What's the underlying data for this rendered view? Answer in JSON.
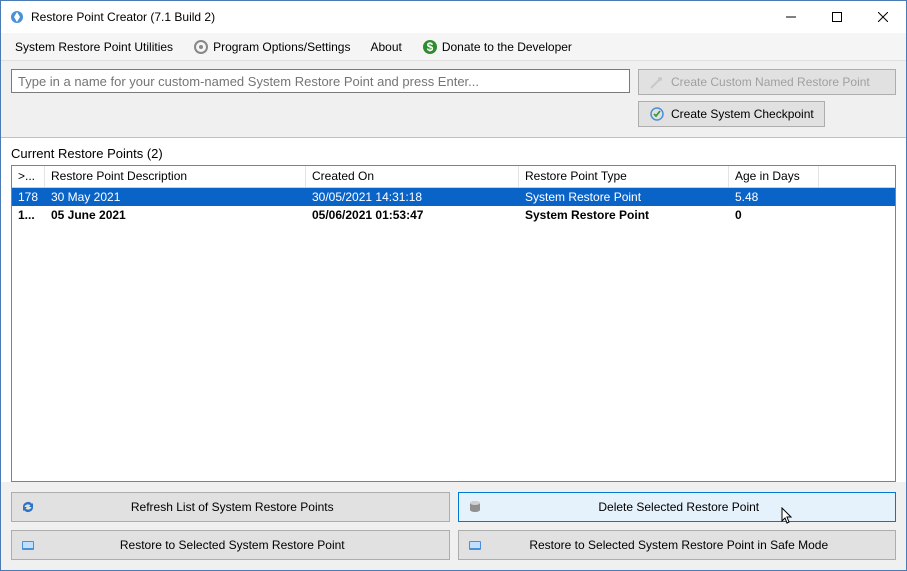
{
  "window": {
    "title": "Restore Point Creator (7.1 Build 2)"
  },
  "menu": {
    "utilities": "System Restore Point Utilities",
    "options": "Program Options/Settings",
    "about": "About",
    "donate": "Donate to the Developer"
  },
  "top": {
    "name_placeholder": "Type in a name for your custom-named System Restore Point and press Enter...",
    "create_named": "Create Custom Named Restore Point",
    "create_checkpoint": "Create System Checkpoint"
  },
  "list": {
    "label": "Current Restore Points (2)",
    "headers": {
      "id": ">...",
      "desc": "Restore Point Description",
      "created": "Created On",
      "type": "Restore Point Type",
      "age": "Age in Days"
    },
    "rows": [
      {
        "id": "178",
        "desc": "30 May 2021",
        "created": "30/05/2021 14:31:18",
        "type": "System Restore Point",
        "age": "5.48",
        "selected": true
      },
      {
        "id": "1...",
        "desc": "05 June 2021",
        "created": "05/06/2021 01:53:47",
        "type": "System Restore Point",
        "age": "0",
        "bold": true
      }
    ]
  },
  "bottom": {
    "refresh": "Refresh List of System Restore Points",
    "restore": "Restore to Selected System Restore Point",
    "delete": "Delete Selected Restore Point",
    "restore_safe": "Restore to Selected System Restore Point in Safe Mode"
  }
}
